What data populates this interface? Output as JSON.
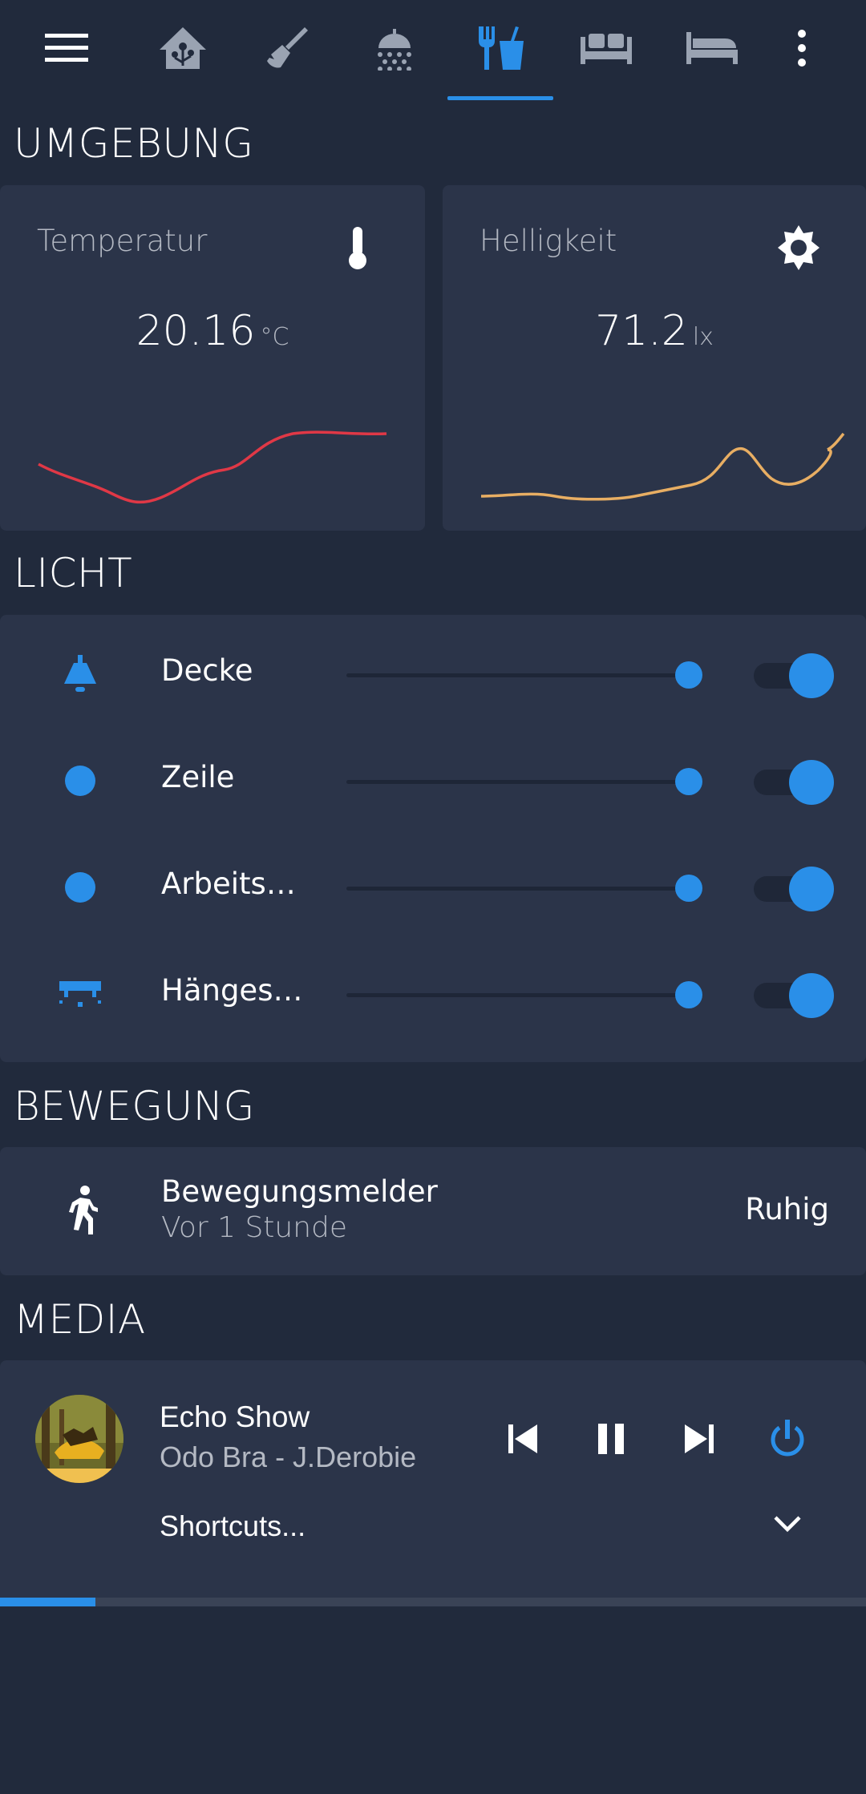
{
  "nav": {
    "tabs": [
      {
        "name": "menu-icon"
      },
      {
        "name": "home-assistant-icon"
      },
      {
        "name": "broom-icon"
      },
      {
        "name": "shower-icon"
      },
      {
        "name": "silverware-drink-icon",
        "active": true
      },
      {
        "name": "sofa-icon"
      },
      {
        "name": "bed-icon"
      },
      {
        "name": "more-vertical-icon"
      }
    ],
    "active_color": "#2a8fe8",
    "icon_color": "#9aa3b2"
  },
  "sections": {
    "environment": "UMGEBUNG",
    "light": "LICHT",
    "motion": "BEWEGUNG",
    "media": "MEDIA"
  },
  "sensors": {
    "temperature": {
      "name": "Temperatur",
      "value": "20.16",
      "unit": "°C",
      "icon": "thermometer-icon",
      "line_color": "#e03846"
    },
    "brightness": {
      "name": "Helligkeit",
      "value": "71.2",
      "unit": "lx",
      "icon": "brightness-icon",
      "line_color": "#e8ae63"
    }
  },
  "lights": [
    {
      "label": "Decke",
      "icon": "ceiling-light-icon",
      "on": true,
      "level": 0.98
    },
    {
      "label": "Zeile",
      "icon": "bulb-dot-icon",
      "on": true,
      "level": 0.98
    },
    {
      "label": "Arbeits…",
      "icon": "bulb-dot-icon",
      "on": true,
      "level": 0.98
    },
    {
      "label": "Hänges…",
      "icon": "pendant-light-icon",
      "on": true,
      "level": 0.98
    }
  ],
  "motion": {
    "name": "Bewegungsmelder",
    "last_changed": "Vor 1 Stunde",
    "state": "Ruhig",
    "icon": "walk-icon"
  },
  "media": {
    "player_name": "Echo Show",
    "track": "Odo Bra - J.Derobie",
    "shortcuts_label": "Shortcuts...",
    "progress": 0.11,
    "accent": "#2a8fe8"
  }
}
